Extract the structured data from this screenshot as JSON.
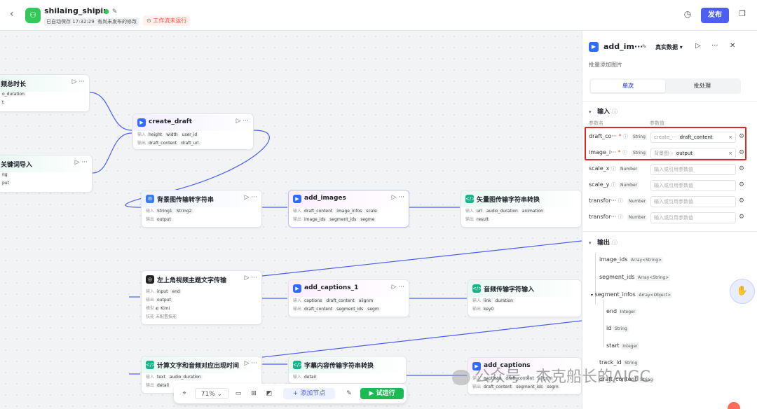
{
  "header": {
    "back_glyph": "‹",
    "app_name": "shilaing_shipin",
    "autosave": "已自动保存 17:32:29",
    "unpublished": "有尚未发布的修改",
    "warning": "工作流未运行",
    "publish_label": "发布"
  },
  "nodes": {
    "n1": {
      "title": "频总时长",
      "r1_chip": "o_duration",
      "r2_chip": "t"
    },
    "n2": {
      "title": "关键词导入",
      "r1_chip": "ng",
      "r2_chip": "put"
    },
    "create_draft": {
      "title": "create_draft",
      "in_label": "输入",
      "out_label": "输出",
      "in1": "height",
      "in2": "width",
      "in3": "user_id",
      "out1": "draft_content",
      "out2": "draft_url"
    },
    "bg_convert": {
      "title": "背景图传输转字符串",
      "in_label": "输入",
      "out_label": "输出",
      "in1": "String1",
      "in2": "String2",
      "out1": "output"
    },
    "add_images": {
      "title": "add_images",
      "in_label": "输入",
      "out_label": "输出",
      "in1": "draft_content",
      "in2": "image_infos",
      "in3": "scale",
      "out1": "image_ids",
      "out2": "segment_ids",
      "out3": "segme"
    },
    "vector_convert": {
      "title": "矢量图传输字符串转换",
      "in_label": "输入",
      "out_label": "输出",
      "in1": "url",
      "in2": "audio_duration",
      "in3": "animation",
      "out1": "result"
    },
    "topleft_video": {
      "title": "左上角视频主题文字传输",
      "in_label": "输入",
      "out_label": "输出",
      "model_label": "模型",
      "skill_label": "技能",
      "in1": "input",
      "in2": "end",
      "out1": "output",
      "model": "Kimi",
      "skill": "未配置技能"
    },
    "add_captions_1": {
      "title": "add_captions_1",
      "in_label": "输入",
      "out_label": "输出",
      "in1": "captions",
      "in2": "draft_content",
      "in3": "alignm",
      "out1": "draft_content",
      "out2": "segment_ids",
      "out3": "segm"
    },
    "audio_input": {
      "title": "音频传输字符输入",
      "in_label": "输入",
      "out_label": "输出",
      "in1": "link",
      "in2": "duration",
      "out1": "key0"
    },
    "calc_text": {
      "title": "计算文字和音频对应出现时间",
      "in_label": "输入",
      "out_label": "输出",
      "in1": "text",
      "in2": "audio_duration",
      "out1": "detail"
    },
    "caption_convert": {
      "title": "字幕内容传输字符串转换",
      "in_label": "输入",
      "out_label": "输出",
      "in1": "detail"
    },
    "add_captions": {
      "title": "add_captions",
      "in_label": "输入",
      "out_label": "输出",
      "in1": "captions",
      "in2": "draft_content",
      "in3": "alignm",
      "out1": "draft_content",
      "out2": "segment_ids",
      "out3": "segm"
    }
  },
  "toolbar": {
    "zoom": "71%",
    "add_node": "添加节点",
    "run": "试运行"
  },
  "panel": {
    "title": "add_im···",
    "mode": "真实数据 ▾",
    "description": "批量添加图片",
    "tabs": [
      "单次",
      "批处理"
    ],
    "input_section": "输入",
    "col_name": "参数名",
    "col_value": "参数值",
    "params": [
      {
        "name": "draft_co···",
        "type": "String",
        "ref": "create_···",
        "value": "draft_content"
      },
      {
        "name": "image_i···",
        "type": "String",
        "ref": "背景图···",
        "value": "output"
      },
      {
        "name": "scale_x",
        "type": "Number",
        "placeholder": "输入或引用参数值"
      },
      {
        "name": "scale_y",
        "type": "Number",
        "placeholder": "输入或引用参数值"
      },
      {
        "name": "transfor···",
        "type": "Number",
        "placeholder": "输入或引用参数值"
      },
      {
        "name": "transfor···",
        "type": "Number",
        "placeholder": "输入或引用参数值"
      }
    ],
    "output_section": "输出",
    "outputs": [
      {
        "name": "image_ids",
        "type": "Array<String>"
      },
      {
        "name": "segment_ids",
        "type": "Array<String>"
      },
      {
        "name": "segment_infos",
        "type": "Array<Object>"
      },
      {
        "name": "end",
        "type": "Integer"
      },
      {
        "name": "id",
        "type": "String"
      },
      {
        "name": "start",
        "type": "Integer"
      },
      {
        "name": "track_id",
        "type": "String"
      },
      {
        "name": "draft_content",
        "type": "String"
      }
    ]
  },
  "watermark": "公众号 · 杰克船长的AIGC",
  "colors": {
    "accent": "#4c5ff2",
    "run": "#1db954",
    "warning": "#e5533c",
    "highlight": "#e0262a",
    "edge": "#4c5ff2"
  }
}
